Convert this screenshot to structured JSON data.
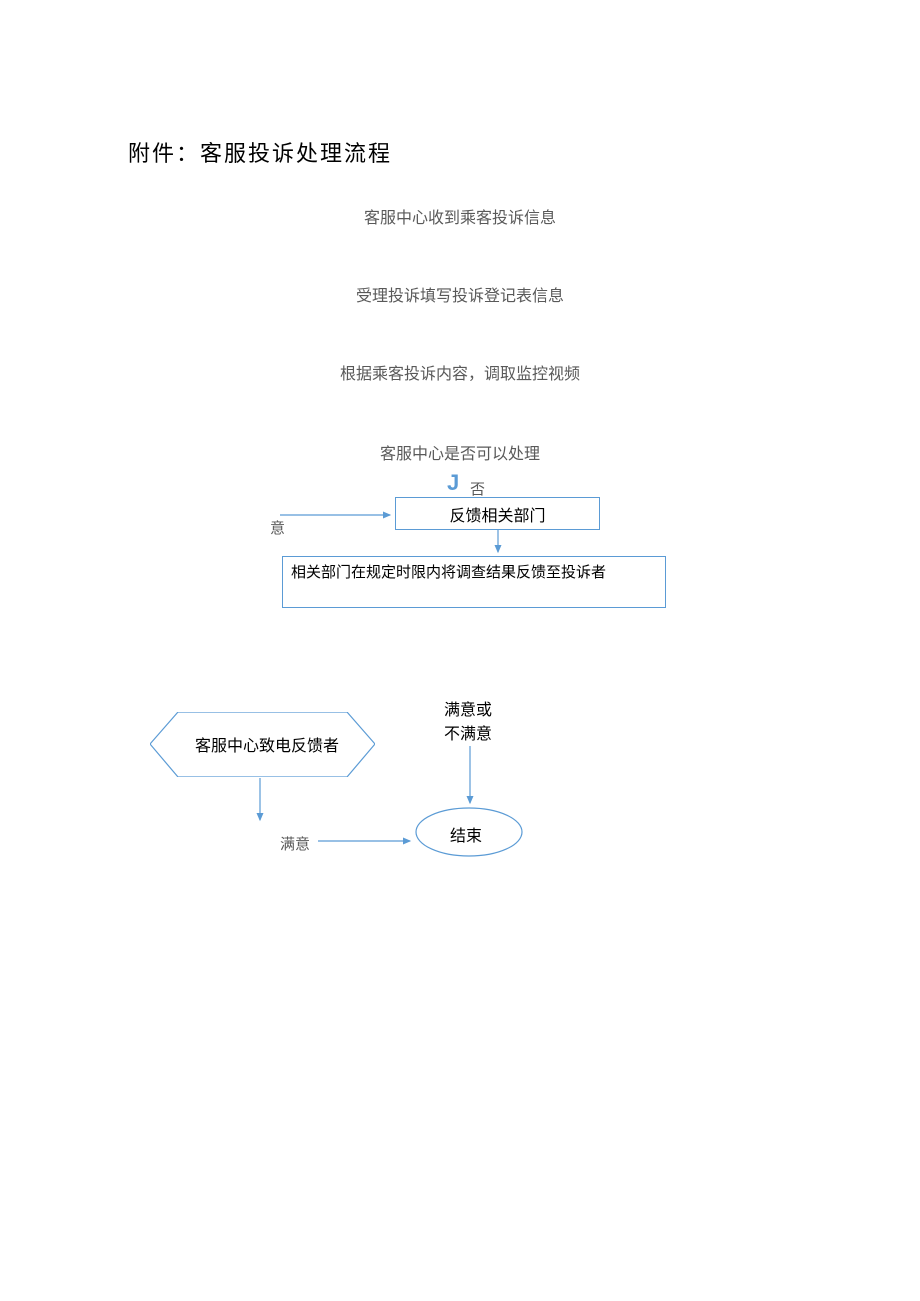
{
  "title": "附件：客服投诉处理流程",
  "steps": {
    "s1": "客服中心收到乘客投诉信息",
    "s2": "受理投诉填写投诉登记表信息",
    "s3": "根据乘客投诉内容，调取监控视频",
    "s4": "客服中心是否可以处理"
  },
  "labels": {
    "j": "J",
    "fou": "否",
    "yi": "意",
    "box1": "反馈相关部门",
    "box2": "相关部门在规定时限内将调查结果反馈至投诉者",
    "hex": "客服中心致电反馈者",
    "manyi_bumanyi": "满意或不满意",
    "end": "结束",
    "manyi2": "满意"
  },
  "colors": {
    "line": "#5b9bd5"
  }
}
